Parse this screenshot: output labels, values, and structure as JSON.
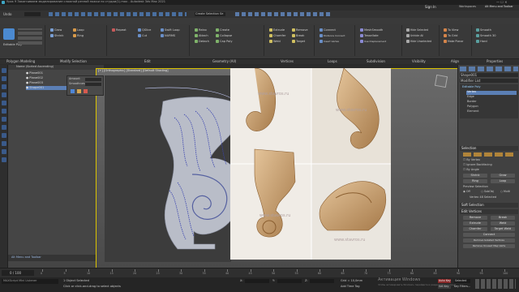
{
  "window": {
    "title": "Урок 9 Заканчиваем моделирование сложной резной ножки по студии(1).max - Autodesk 3ds Max 2021",
    "sign_in": "Sign In",
    "workspaces": "Workspaces",
    "workspace_value": "Alt Menu and Toolbar"
  },
  "menu": [
    "File",
    "Edit",
    "Tools",
    "Group",
    "Views",
    "Create",
    "Modifiers",
    "Animation",
    "Graph Editors",
    "Rendering",
    "Civil View",
    "Customize",
    "Scripting",
    "Interactive",
    "Content",
    "Arnold",
    "Help"
  ],
  "toolbar": {
    "undo_label": "Undo",
    "view_dropdown": "View",
    "create_selection_set": "Create Selection Se"
  },
  "ribbon_tabs": [
    "Modeling",
    "Freeform",
    "Selection",
    "Object Paint",
    "Populate"
  ],
  "ribbon": {
    "polygon_modeling": "Polygon Modeling",
    "modify_selection": "Modify Selection",
    "edit": "Edit",
    "geometry_all": "Geometry (All)",
    "vertices": "Vertices",
    "loops": "Loops",
    "subdivision": "Subdivision",
    "visibility": "Visibility",
    "align": "Align",
    "properties": "Properties",
    "buttons": {
      "editable_poly": "Editable Poly",
      "grow": "Grow",
      "shrink": "Shrink",
      "loop": "Loop",
      "ring": "Ring",
      "repeat": "Repeat",
      "quickslice": "QSlice",
      "swift_loop": "Swift Loop",
      "cut": "Cut",
      "nurms": "NURMS",
      "relax": "Relax",
      "create": "Create",
      "collapse": "Collapse",
      "detach": "Detach",
      "attach": "Attach",
      "cap_poly": "Cap Poly",
      "extrude": "Extrude",
      "chamfer": "Chamfer",
      "weld": "Weld",
      "remove": "Remove",
      "break": "Break",
      "target": "Target",
      "connect": "Connect",
      "distance_connect": "Distance Connect",
      "insert_vertex": "Insert Vertex",
      "meshsmooth": "MeshSmooth",
      "tessellate": "Tessellate",
      "use_displacement": "Use Displacement",
      "hide_selected": "Hide Selected",
      "unhide_all": "Unhide All",
      "hide_unselected": "Hide Unselected",
      "to_view": "To View",
      "to_grid": "To Grid",
      "make_planar": "Make Planar",
      "smooth": "Smooth",
      "smooth30": "Smooth 30",
      "hard": "Hard"
    }
  },
  "explorer": {
    "header": "Name (Sorted Ascending)",
    "items": [
      {
        "label": "Plane001"
      },
      {
        "label": "Plane002"
      },
      {
        "label": "Plane003"
      },
      {
        "label": "Shape001"
      }
    ]
  },
  "dialog": {
    "label1": "Amount",
    "label2": "Smoothness"
  },
  "viewport": {
    "label": "[+] [Orthographic] [Standard] [Default Shading]"
  },
  "watermark": "www.stavros.ru",
  "right_panel": {
    "object_name": "Shape001",
    "modifier_list": "Modifier List",
    "stack": [
      {
        "label": "Editable Poly"
      },
      {
        "label": "Vertex"
      },
      {
        "label": "Edge"
      },
      {
        "label": "Border"
      },
      {
        "label": "Polygon"
      },
      {
        "label": "Element"
      }
    ],
    "selection_header": "Selection",
    "by_vertex": "By Vertex",
    "ignore_backfacing": "Ignore Backfacing",
    "by_angle": "By Angle",
    "shrink": "Shrink",
    "grow": "Grow",
    "ring": "Ring",
    "loop": "Loop",
    "preview_selection": "Preview Selection",
    "off": "Off",
    "subobj": "SubObj",
    "multi": "Multi",
    "vertices_selected": "Vertex 48 Selected",
    "soft_selection": "Soft Selection",
    "edit_vertices": "Edit Vertices",
    "remove": "Remove",
    "break": "Break",
    "extrude": "Extrude",
    "weld": "Weld",
    "chamfer": "Chamfer",
    "target_weld": "Target Weld",
    "connect": "Connect",
    "remove_isolated": "Remove Isolated Vertices",
    "remove_unused": "Remove Unused Map Verts"
  },
  "timeline": {
    "frame_display": "0 / 100",
    "ticks": [
      "0",
      "5",
      "10",
      "15",
      "20",
      "25",
      "30",
      "35",
      "40",
      "45",
      "50",
      "55",
      "60",
      "65",
      "70",
      "75",
      "80",
      "85",
      "90",
      "95",
      "100"
    ]
  },
  "status": {
    "script_listener": "MAXScript Mini Listener",
    "selected": "1 Object Selected",
    "prompt": "Click or click-and-drag to select objects",
    "grid": "Grid = 10,0mm",
    "add_time_tag": "Add Time Tag",
    "activation_title": "Активация Windows",
    "activation_sub": "Чтобы активировать Windows, перейдите в раздел \"Параметры\".",
    "auto_key": "Auto Key",
    "selected_dropdown": "Selected",
    "set_key": "Set Key",
    "key_filters": "Key Filters...",
    "x_coord": "X:",
    "y_coord": "Y:",
    "z_coord": "Z:"
  },
  "colors": {
    "accent": "#5b7fb5",
    "viewport_border": "#d9c200",
    "wood": "#c9a27a"
  }
}
